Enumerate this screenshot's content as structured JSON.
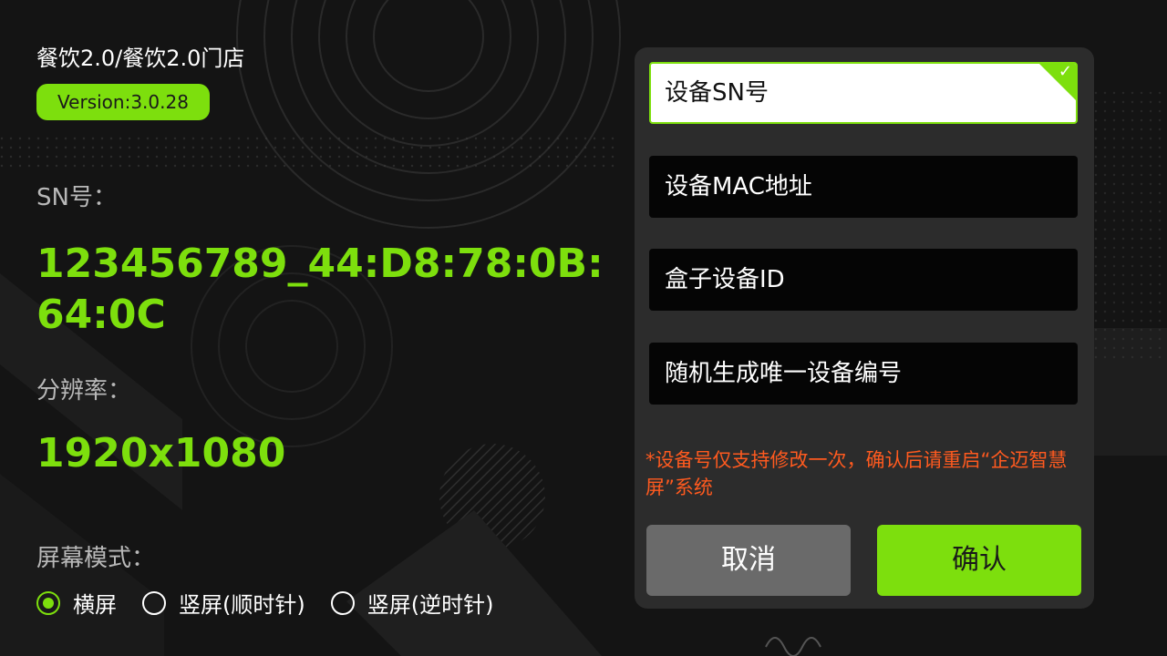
{
  "header": {
    "breadcrumb": "餐饮2.0/餐饮2.0门店",
    "version": "Version:3.0.28"
  },
  "info": {
    "sn_label": "SN号：",
    "sn_value_line1": "123456789_44:D8:78:0B:",
    "sn_value_line2": "64:0C",
    "resolution_label": "分辨率：",
    "resolution_value": "1920x1080",
    "screen_mode_label": "屏幕模式："
  },
  "screen_modes": [
    {
      "label": "横屏",
      "checked": true
    },
    {
      "label": "竖屏(顺时针)",
      "checked": false
    },
    {
      "label": "竖屏(逆时针)",
      "checked": false
    }
  ],
  "options": [
    {
      "label": "设备SN号",
      "selected": true
    },
    {
      "label": "设备MAC地址",
      "selected": false
    },
    {
      "label": "盒子设备ID",
      "selected": false
    },
    {
      "label": "随机生成唯一设备编号",
      "selected": false
    }
  ],
  "notice": "*设备号仅支持修改一次，确认后请重启“企迈智慧屏”系统",
  "buttons": {
    "cancel": "取消",
    "confirm": "确认"
  },
  "colors": {
    "accent": "#7ddf0d",
    "warning": "#ff5a1f",
    "background": "#121212"
  },
  "icons": {
    "check": "✓"
  }
}
